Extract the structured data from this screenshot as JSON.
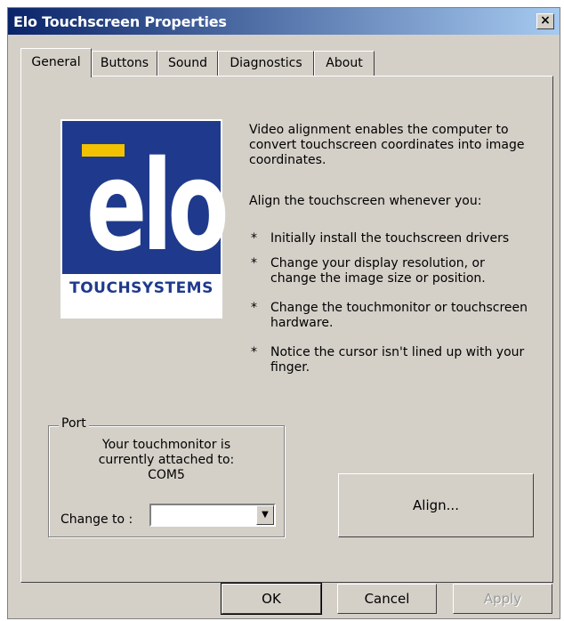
{
  "window": {
    "title": "Elo Touchscreen Properties",
    "close_label": "×"
  },
  "tabs": [
    {
      "label": "General",
      "active": true
    },
    {
      "label": "Buttons"
    },
    {
      "label": "Sound"
    },
    {
      "label": "Diagnostics"
    },
    {
      "label": "About"
    }
  ],
  "logo": {
    "wordmark": "elo",
    "subtitle": "TOUCHSYSTEMS"
  },
  "general": {
    "intro": "Video alignment enables the computer to convert touchscreen coordinates into image coordinates.",
    "align_when": "Align the touchscreen whenever you:",
    "bullets": [
      "Initially install the touchscreen drivers",
      "Change your display resolution, or change the image size or position.",
      "Change the touchmonitor or touchscreen hardware.",
      "Notice the cursor isn't lined up with your finger."
    ],
    "bullet_marker": "*"
  },
  "port": {
    "legend": "Port",
    "message_line1": "Your touchmonitor is",
    "message_line2": "currently attached to:",
    "current_port": "COM5",
    "change_label": "Change to :",
    "change_value": ""
  },
  "align_button": "Align...",
  "footer": {
    "ok": "OK",
    "cancel": "Cancel",
    "apply": "Apply"
  }
}
